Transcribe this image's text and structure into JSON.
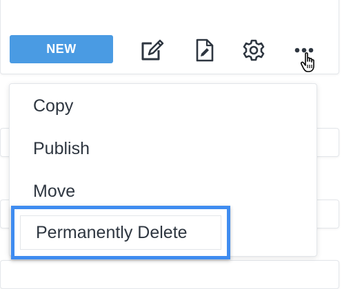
{
  "toolbar": {
    "new_label": "NEW",
    "icons": [
      "edit-icon",
      "document-edit-icon",
      "gear-icon",
      "more-options-icon"
    ]
  },
  "menu": {
    "items": [
      {
        "label": "Copy"
      },
      {
        "label": "Publish"
      },
      {
        "label": "Move"
      },
      {
        "label": "Permanently Delete"
      }
    ]
  },
  "colors": {
    "accent": "#4a9be3",
    "highlight_border": "#3f8cf0",
    "icon": "#2e3640",
    "text": "#2e3640"
  },
  "cursor": "hand-pointer-icon"
}
